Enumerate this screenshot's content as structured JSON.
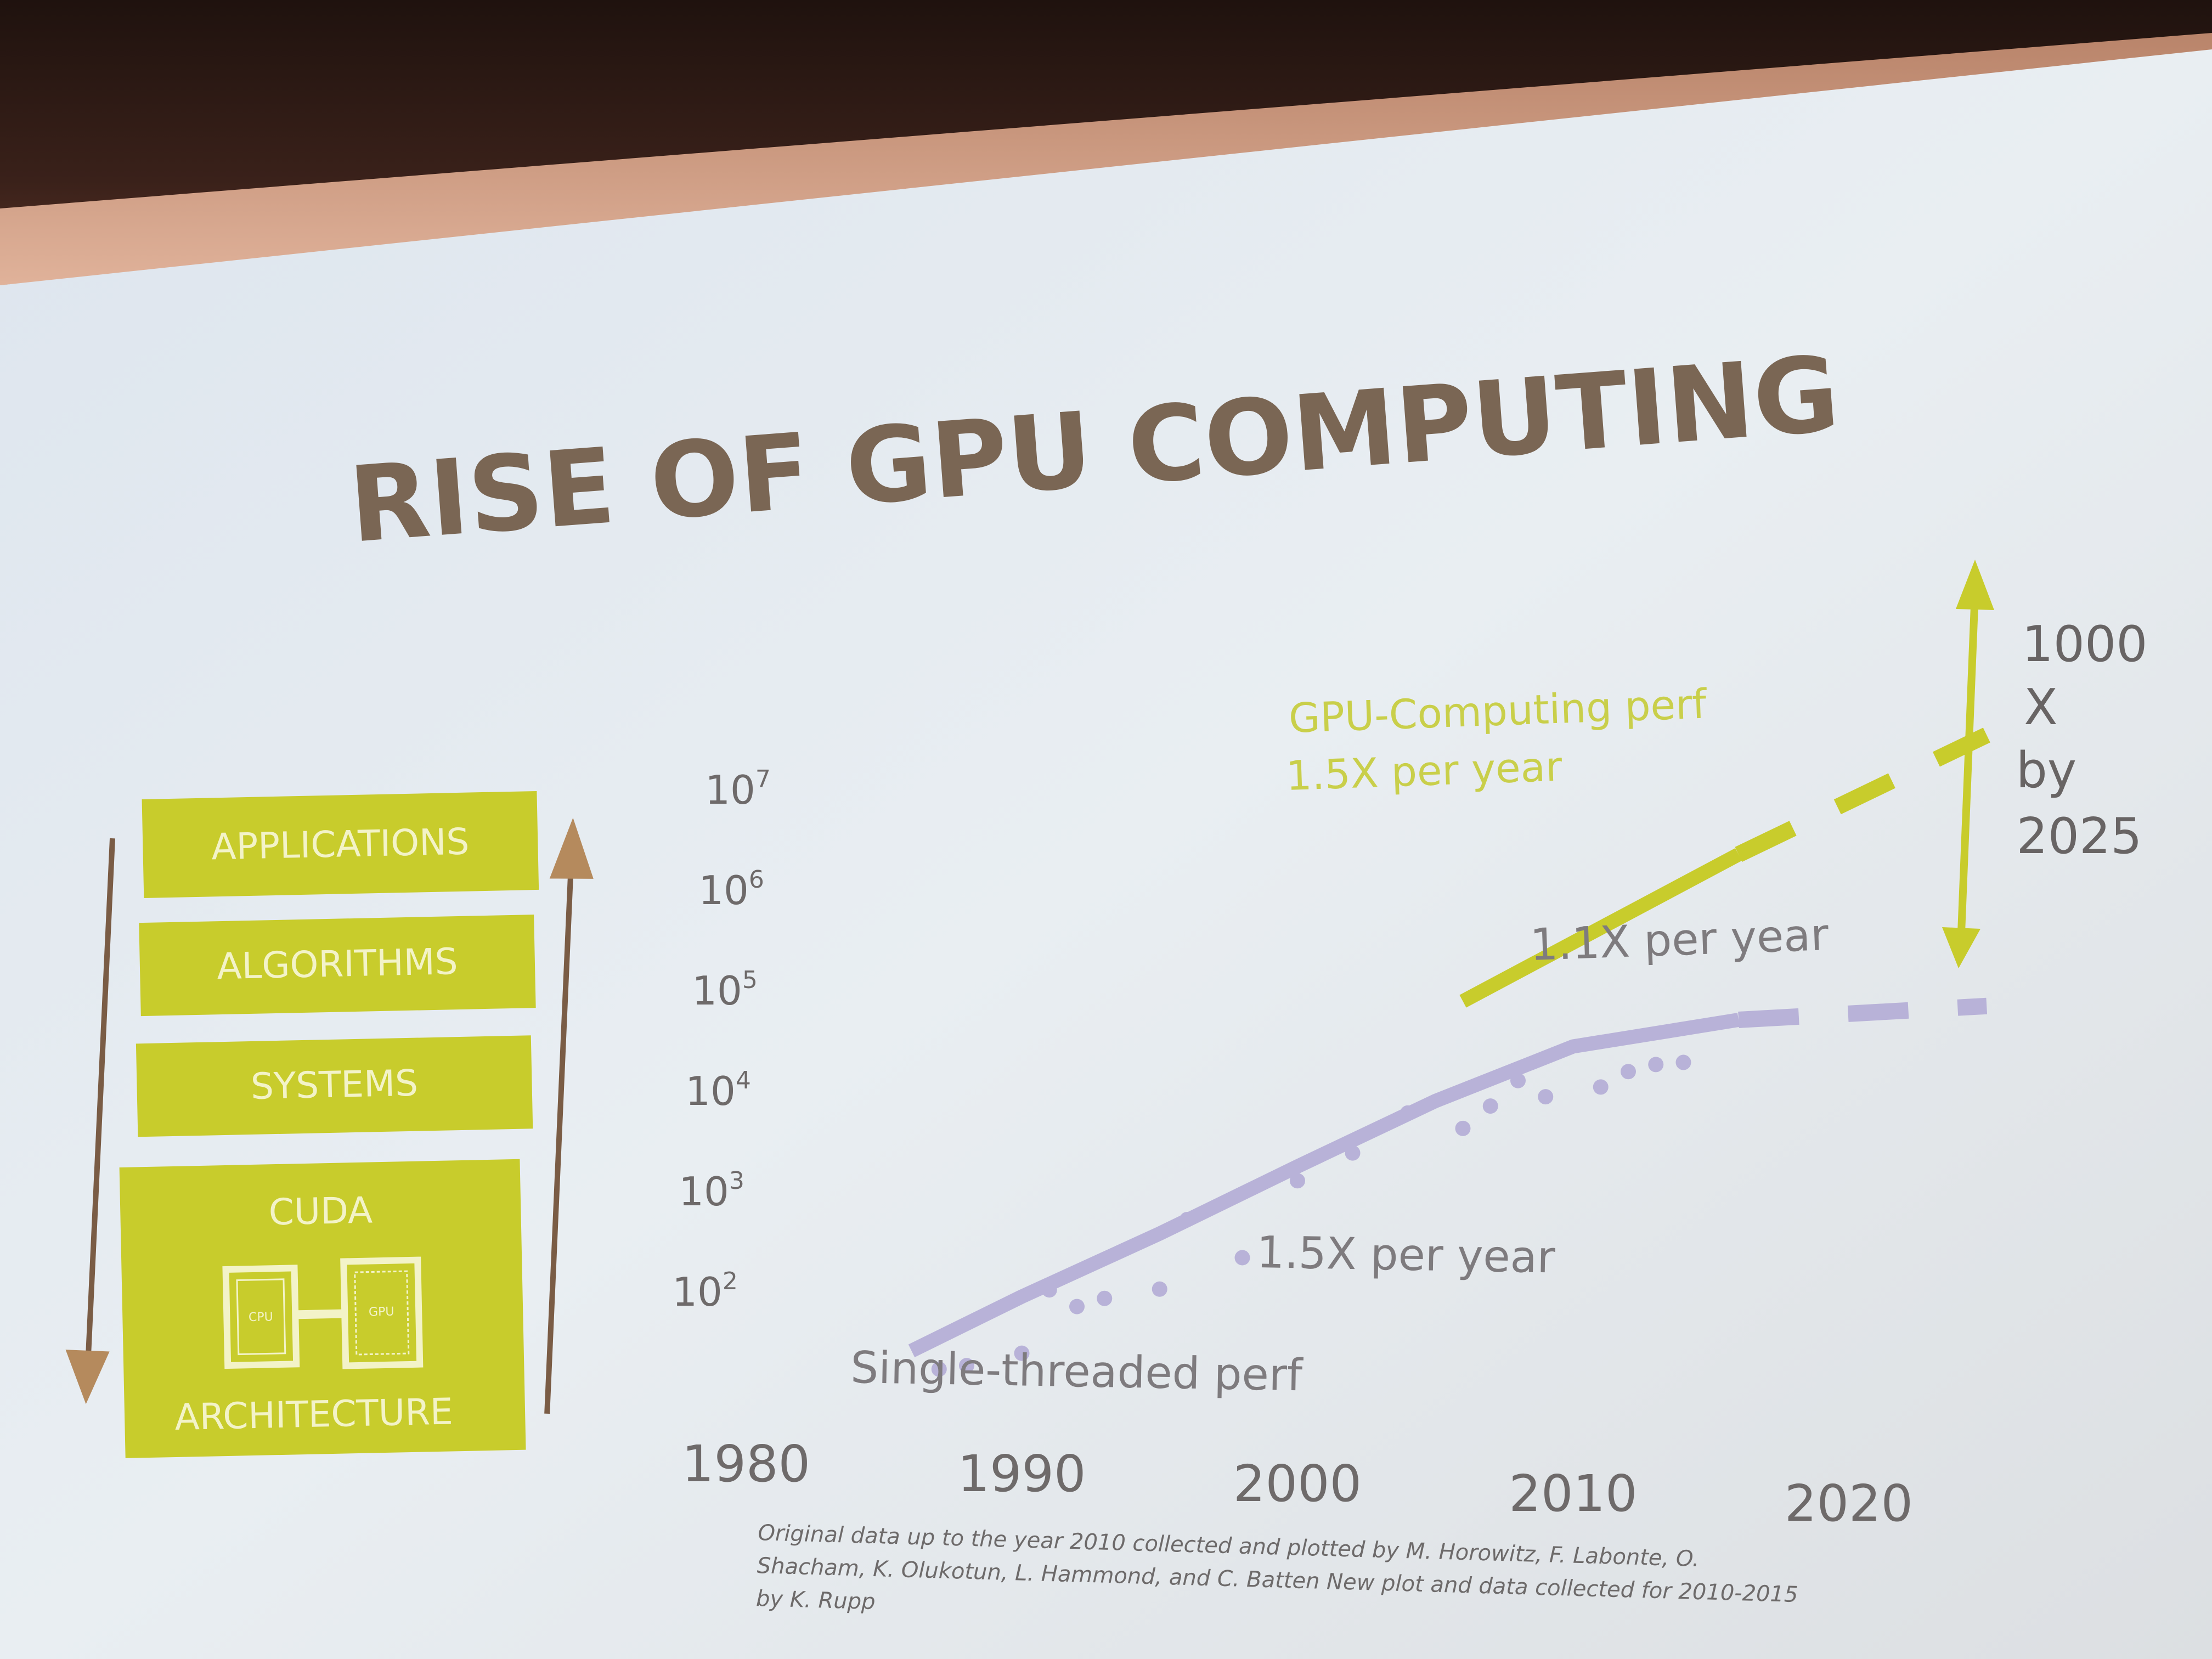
{
  "slide": {
    "title": "RISE OF GPU COMPUTING"
  },
  "stack": {
    "layers": [
      "APPLICATIONS",
      "ALGORITHMS",
      "SYSTEMS",
      "CUDA"
    ],
    "architecture_label": "ARCHITECTURE",
    "cpu_label": "CPU",
    "gpu_label": "GPU",
    "accent_color": "#c8cc2c"
  },
  "chart_data": {
    "type": "line",
    "title": "",
    "xlabel": "",
    "ylabel": "",
    "y_scale": "log",
    "x_ticks": [
      "1980",
      "1990",
      "2000",
      "2010",
      "2020"
    ],
    "y_ticks": [
      "10^2",
      "10^3",
      "10^4",
      "10^5",
      "10^6",
      "10^7"
    ],
    "xlim": [
      1980,
      2025
    ],
    "ylim": [
      10,
      10000000
    ],
    "series": [
      {
        "name": "GPU-Computing perf",
        "color": "#c8cc2c",
        "style": "solid",
        "x": [
          2006,
          2016
        ],
        "y": [
          120000,
          4000000
        ]
      },
      {
        "name": "GPU-Computing perf projection",
        "color": "#c8cc2c",
        "style": "dashed",
        "x": [
          2016,
          2025
        ],
        "y": [
          4000000,
          70000000
        ]
      },
      {
        "name": "Single-threaded perf",
        "color": "#b8b2d8",
        "style": "solid",
        "x": [
          1986,
          1990,
          1995,
          2000,
          2005,
          2010,
          2016
        ],
        "y": [
          30,
          110,
          500,
          2500,
          12000,
          45000,
          90000
        ]
      },
      {
        "name": "Single-threaded perf projection",
        "color": "#b8b2d8",
        "style": "dashed",
        "x": [
          2016,
          2025
        ],
        "y": [
          90000,
          140000
        ]
      },
      {
        "name": "Single-threaded perf samples",
        "color": "#b8b2d8",
        "style": "points",
        "x": [
          1987,
          1988,
          1990,
          1991,
          1992,
          1993,
          1995,
          1996,
          1998,
          2000,
          2002,
          2004,
          2006,
          2007,
          2008,
          2009,
          2011,
          2012,
          2013,
          2014
        ],
        "y": [
          20,
          22,
          30,
          130,
          90,
          110,
          140,
          700,
          300,
          1800,
          3500,
          9000,
          6500,
          11000,
          20000,
          14000,
          18000,
          26000,
          31000,
          33000
        ]
      }
    ],
    "annotations": {
      "gpu_label_line1": "GPU-Computing perf",
      "gpu_label_line2": "1.5X per year",
      "single_late": "1.1X per year",
      "single_early": "1.5X per year",
      "single_name": "Single-threaded perf",
      "gap_line1": "1000",
      "gap_line2": "X",
      "gap_line3": "by",
      "gap_line4": "2025"
    }
  },
  "credit": {
    "line1": "Original data up to the year 2010 collected and plotted by M. Horowitz, F. Labonte, O.",
    "line2": "Shacham, K. Olukotun, L. Hammond, and C. Batten New plot and data collected for 2010-2015",
    "line3": "by K. Rupp"
  }
}
